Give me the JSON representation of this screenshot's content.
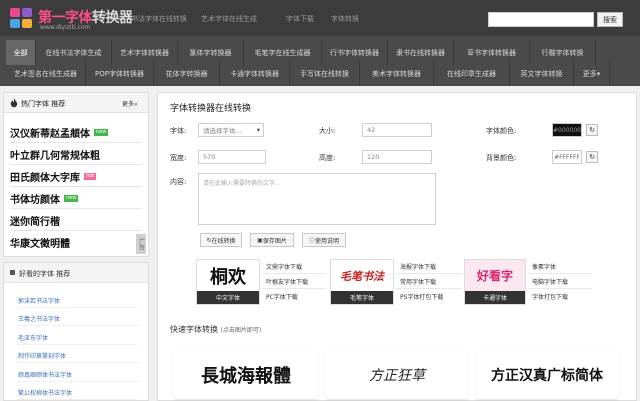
{
  "header": {
    "logo_title": "第一字体",
    "logo_sub": "转换器",
    "logo_url": "www.diyiziti.com",
    "links": [
      "书法字体在线转换",
      "艺术字体在线生成",
      "字体下载",
      "字体转换"
    ],
    "search_placeholder": "",
    "search_button": "搜索"
  },
  "nav": {
    "row1": [
      "全部",
      "在线书法字体生成",
      "艺术字体转换器",
      "篆体字转换器",
      "毛笔字在线生成器",
      "行书字体转换器",
      "隶书在线转换器",
      "草书字体转换器",
      "行楷字体转换"
    ],
    "row2": [
      "艺术签名在线生成器",
      "POP字体转换器",
      "花体字转换器",
      "卡通字体转换器",
      "手写体在线转换",
      "美术字体转换器",
      "在线印章生成器",
      "英文字体转换",
      "更多▾"
    ]
  },
  "sidebar_hot": {
    "title": "热门字体 推荐",
    "more": "更多»",
    "items": [
      {
        "text": "汉仪新蒂赵孟頫体",
        "badge": "new"
      },
      {
        "text": "叶立群几何常规体粗",
        "badge": ""
      },
      {
        "text": "田氏颜体大字库",
        "badge": "hot"
      },
      {
        "text": "书体坊颜体",
        "badge": "new"
      },
      {
        "text": "迷你简行楷",
        "badge": ""
      },
      {
        "text": "华康文徵明體",
        "badge": ""
      }
    ],
    "ad_label": "广告"
  },
  "sidebar_fav": {
    "title": "好看的字体 推荐",
    "items": [
      "郭沫若书法字体",
      "王羲之书法字体",
      "毛泽东字体",
      "制作印章篆刻字体",
      "颜真卿颜体书法字体",
      "繁公权柳体书法字体"
    ]
  },
  "main": {
    "title": "字体转换器在线转换",
    "font_label": "字体:",
    "font_select": "请选择字体...",
    "size_label": "大小:",
    "size_value": "42",
    "color_label": "字体颜色:",
    "color_value": "#000000",
    "width_label": "宽度:",
    "width_value": "570",
    "height_label": "高度:",
    "height_value": "120",
    "bg_label": "背景颜色:",
    "bg_value": "#FFFFFF",
    "content_label": "内容:",
    "content_placeholder": "请在此输入需要转换的文字...",
    "convert_button": "在线转换",
    "save_button": "保存图片",
    "help_button": "使用说明",
    "color_picker_glyph": "↻",
    "quick_title": "快速字体转换",
    "quick_sub": "(点击图片即可)"
  },
  "promos": [
    {
      "art": "桐欢",
      "caption": "中文字体",
      "links": [
        "文鼎字体下载",
        "叶根友字体下载",
        "PC字体下载"
      ]
    },
    {
      "art": "毛笔书法",
      "caption": "毛笔字体",
      "links": [
        "海报字体下载",
        "常用字体下载",
        "PS字体打包下载"
      ]
    },
    {
      "art": "好看字",
      "caption": "卡通字体",
      "links": [
        "像素字体",
        "电脑字体下载",
        "字体打包下载"
      ]
    }
  ],
  "samples": [
    "長城海報體",
    "方正狂草",
    "方正汉真广标简体"
  ],
  "colors": {
    "topbar": "#3c3c3c",
    "nav": "#4a4a4a",
    "nav_active": "#676767",
    "logo_pink": "#ff4e8a",
    "link_blue": "#3a6fb7",
    "badge_new": "#45b649",
    "badge_hot": "#f36b9a"
  }
}
